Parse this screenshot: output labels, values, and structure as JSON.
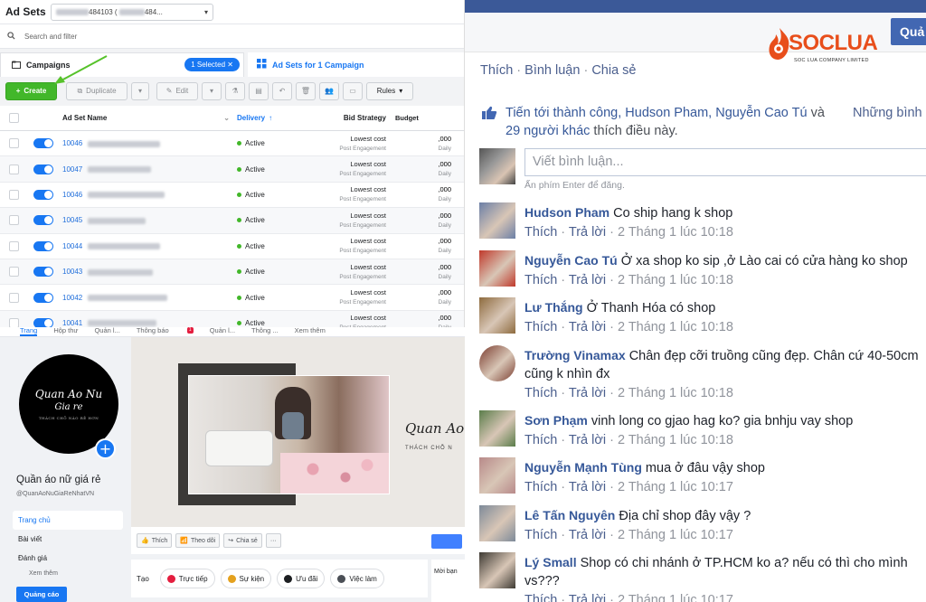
{
  "ads_manager": {
    "title": "Ad Sets",
    "account_select": "484103 (",
    "account_select_tail": "484...",
    "search_placeholder": "Search and filter",
    "campaigns_tab": "Campaigns",
    "selected_badge": "1 Selected",
    "adsets_tab": "Ad Sets for 1 Campaign",
    "toolbar": {
      "create": "Create",
      "duplicate": "Duplicate",
      "edit": "Edit",
      "rules": "Rules"
    },
    "columns": {
      "name": "Ad Set Name",
      "delivery": "Delivery",
      "bid": "Bid Strategy",
      "budget": "Budget"
    },
    "rows": [
      {
        "id": "10046",
        "delivery": "Active",
        "bid": "Lowest cost",
        "bid_sub": "Post Engagement",
        "budget": ",000",
        "budget_sub": "Daily"
      },
      {
        "id": "10047",
        "delivery": "Active",
        "bid": "Lowest cost",
        "bid_sub": "Post Engagement",
        "budget": ",000",
        "budget_sub": "Daily"
      },
      {
        "id": "10046",
        "delivery": "Active",
        "bid": "Lowest cost",
        "bid_sub": "Post Engagement",
        "budget": ",000",
        "budget_sub": "Daily"
      },
      {
        "id": "10045",
        "delivery": "Active",
        "bid": "Lowest cost",
        "bid_sub": "Post Engagement",
        "budget": ",000",
        "budget_sub": "Daily"
      },
      {
        "id": "10044",
        "delivery": "Active",
        "bid": "Lowest cost",
        "bid_sub": "Post Engagement",
        "budget": ",000",
        "budget_sub": "Daily"
      },
      {
        "id": "10043",
        "delivery": "Active",
        "bid": "Lowest cost",
        "bid_sub": "Post Engagement",
        "budget": ",000",
        "budget_sub": "Daily"
      },
      {
        "id": "10042",
        "delivery": "Active",
        "bid": "Lowest cost",
        "bid_sub": "Post Engagement",
        "budget": ",000",
        "budget_sub": "Daily"
      },
      {
        "id": "10041",
        "delivery": "Active",
        "bid": "Lowest cost",
        "bid_sub": "Post Engagement",
        "budget": ",000",
        "budget_sub": "Daily"
      }
    ]
  },
  "fb_page": {
    "nav": [
      "Trang",
      "Hộp thư",
      "Quản l...",
      "Thông báo",
      "Quản l...",
      "Thông ...",
      "Xem thêm"
    ],
    "notification_count": "1",
    "logo": {
      "line1": "Quan Ao Nu",
      "line2": "Gia re",
      "line3": "THÁCH CHỖ NÀO RẺ HƠN"
    },
    "name": "Quần áo nữ giá rẻ",
    "handle": "@QuanAoNuGiaReNhatVN",
    "menu": [
      "Trang chủ",
      "Bài viết",
      "Đánh giá"
    ],
    "see_more": "Xem thêm",
    "ads_button": "Quảng cáo",
    "cover_brand": "Quan Ao",
    "cover_sub": "THÁCH CHỖ N",
    "actions": [
      "Thích",
      "Theo dõi",
      "Chia sẻ",
      "···"
    ],
    "create_label": "Tạo",
    "create_items": [
      "Trực tiếp",
      "Sự kiện",
      "Ưu đãi",
      "Việc làm"
    ],
    "invite": "Mời bạn"
  },
  "comments_panel": {
    "top_button": "Quả",
    "logo_text": "SOCLUA",
    "logo_sub": "SOC LUA COMPANY LIMITED",
    "actions": [
      "Thích",
      "Bình luận",
      "Chia sẻ"
    ],
    "likes_prefix": "Tiến tới thành công, Hudson Pham, Nguyễn Cao Tú",
    "likes_and": "và",
    "likes_others": "29 người khác",
    "likes_suffix": "thích điều này.",
    "likes_more": "Những bình",
    "comment_placeholder": "Viết bình luận...",
    "enter_hint": "Ấn phím Enter để đăng.",
    "like_label": "Thích",
    "reply_label": "Trả lời",
    "items": [
      {
        "author": "Hudson Pham",
        "text": "Co ship hang k shop",
        "time": "2 Tháng 1 lúc 10:18",
        "avatar": "#6b7fa6"
      },
      {
        "author": "Nguyễn Cao Tú",
        "text": "Ở xa shop ko sip ,ở Lào cai có cửa hàng ko shop",
        "time": "2 Tháng 1 lúc 10:18",
        "avatar": "#c0392b"
      },
      {
        "author": "Lư Thắng",
        "text": "Ở Thanh Hóa có shop",
        "time": "2 Tháng 1 lúc 10:18",
        "avatar": "#8e6b3e"
      },
      {
        "author": "Trường Vinamax",
        "text": "Chân đẹp cỡi truồng cũng đẹp. Chân cứ 40-50cm cũng k nhìn đx",
        "time": "2 Tháng 1 lúc 10:18",
        "avatar": "#7a3b2e"
      },
      {
        "author": "Sơn Phạm",
        "text": "vinh long co gjao hag ko? gia bnhju vay shop",
        "time": "2 Tháng 1 lúc 10:18",
        "avatar": "#5a7d4a"
      },
      {
        "author": "Nguyễn Mạnh Tùng",
        "text": "mua ở đâu vậy shop",
        "time": "2 Tháng 1 lúc 10:17",
        "avatar": "#b88a8a"
      },
      {
        "author": "Lê Tấn Nguyên",
        "text": "Địa chỉ shop đây vậy ?",
        "time": "2 Tháng 1 lúc 10:17",
        "avatar": "#7d8a99"
      },
      {
        "author": "Lý Small",
        "text": "Shop có chi nhánh ở TP.HCM ko a? nếu có thì cho mình vs???",
        "time": "2 Tháng 1 lúc 10:17",
        "avatar": "#3e3a33"
      }
    ]
  }
}
